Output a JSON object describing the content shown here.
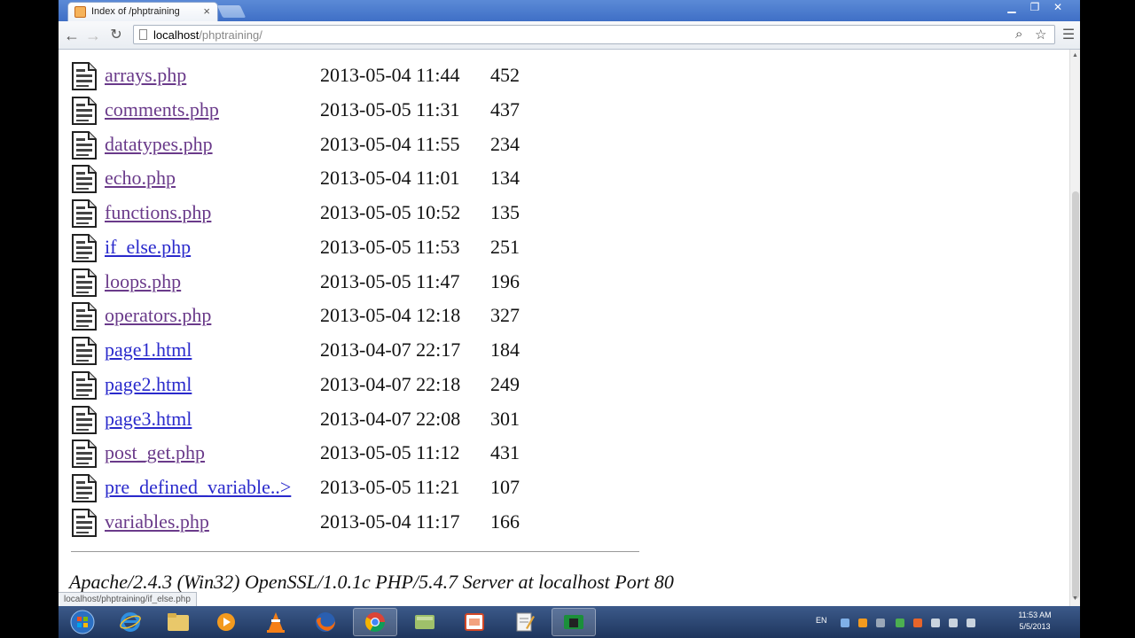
{
  "browser": {
    "tab_title": "Index of /phptraining",
    "tab_close": "×",
    "url_host": "localhost",
    "url_path": "/phptraining/",
    "status_url": "localhost/phptraining/if_else.php"
  },
  "listing": [
    {
      "name": "arrays.php",
      "date": "2013-05-04 11:44",
      "size": "452",
      "visited": true
    },
    {
      "name": "comments.php",
      "date": "2013-05-05 11:31",
      "size": "437",
      "visited": true
    },
    {
      "name": "datatypes.php",
      "date": "2013-05-04 11:55",
      "size": "234",
      "visited": true
    },
    {
      "name": "echo.php",
      "date": "2013-05-04 11:01",
      "size": "134",
      "visited": true
    },
    {
      "name": "functions.php",
      "date": "2013-05-05 10:52",
      "size": "135",
      "visited": true
    },
    {
      "name": "if_else.php",
      "date": "2013-05-05 11:53",
      "size": "251",
      "visited": false
    },
    {
      "name": "loops.php",
      "date": "2013-05-05 11:47",
      "size": "196",
      "visited": true
    },
    {
      "name": "operators.php",
      "date": "2013-05-04 12:18",
      "size": "327",
      "visited": true
    },
    {
      "name": "page1.html",
      "date": "2013-04-07 22:17",
      "size": "184",
      "visited": false
    },
    {
      "name": "page2.html",
      "date": "2013-04-07 22:18",
      "size": "249",
      "visited": false
    },
    {
      "name": "page3.html",
      "date": "2013-04-07 22:08",
      "size": "301",
      "visited": false
    },
    {
      "name": "post_get.php",
      "date": "2013-05-05 11:12",
      "size": "431",
      "visited": true
    },
    {
      "name": "pre_defined_variable..>",
      "date": "2013-05-05 11:21",
      "size": "107",
      "visited": false
    },
    {
      "name": "variables.php",
      "date": "2013-05-04 11:17",
      "size": "166",
      "visited": true
    }
  ],
  "server_signature": "Apache/2.4.3 (Win32) OpenSSL/1.0.1c PHP/5.4.7 Server at localhost Port 80",
  "taskbar": {
    "lang": "EN",
    "time": "11:53 AM",
    "date": "5/5/2013"
  },
  "colors": {
    "link": "#2a2acc",
    "visited": "#6a3a8a",
    "taskbar": "#1e355d"
  }
}
